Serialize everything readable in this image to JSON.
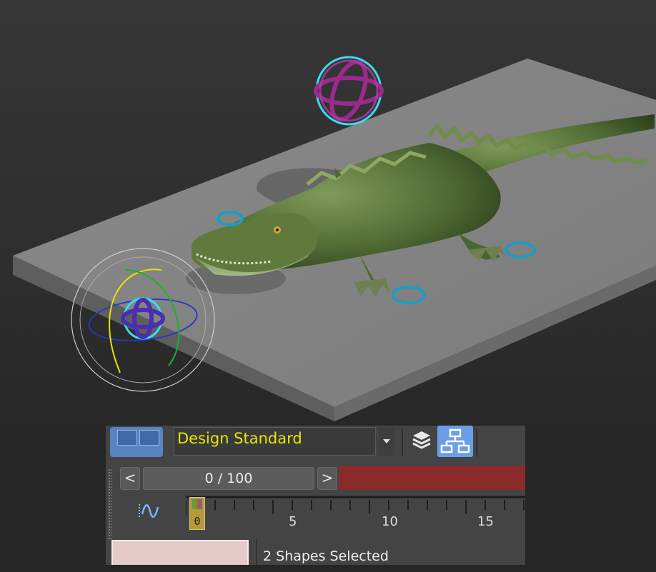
{
  "viewport": {
    "scene": "alligator on slab with rig controls"
  },
  "toolbar": {
    "workspace_name": "Design Standard",
    "workspace_icon": "viewport-layout-icon",
    "layers_icon": "layers-icon",
    "scene_explorer_icon": "scene-explorer-icon"
  },
  "timeline": {
    "prev_label": "<",
    "next_label": ">",
    "slider_text": "0 / 100",
    "current_frame": "0",
    "ruler_labels": [
      "5",
      "10",
      "15"
    ],
    "curve_icon": "curve-editor-icon"
  },
  "status": {
    "selection_text": "2 Shapes Selected"
  },
  "colors": {
    "accent_blue": "#5a83c4",
    "workspace_text": "#e9e600",
    "key_bar": "#8a2b2b",
    "selection_swatch": "#e6caca"
  }
}
